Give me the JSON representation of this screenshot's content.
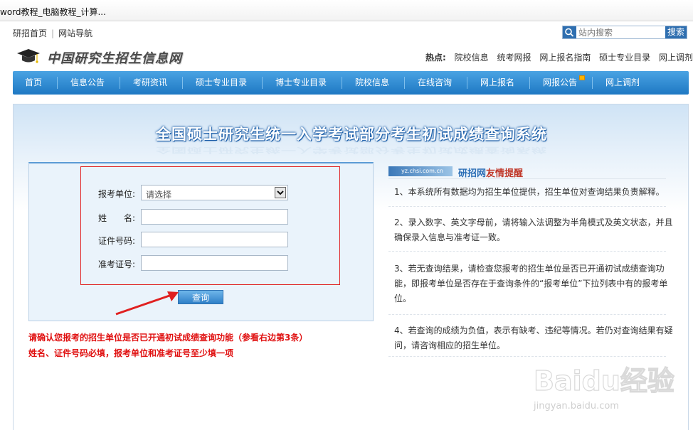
{
  "browser": {
    "tab_title": "word教程_电脑教程_计算..."
  },
  "topbar": {
    "home_link": "研招首页",
    "nav_link": "网站导航",
    "search_placeholder": "站内搜索",
    "search_button": "搜索"
  },
  "header": {
    "logo_text": "中国研究生招生信息网",
    "hot_label": "热点:",
    "hot_links": [
      "院校信息",
      "统考网报",
      "网上报名指南",
      "硕士专业目录",
      "网上调剂"
    ]
  },
  "nav": {
    "items": [
      "首页",
      "信息公告",
      "考研资讯",
      "硕士专业目录",
      "博士专业目录",
      "院校信息",
      "在线咨询",
      "网上报名",
      "网报公告",
      "网上调剂"
    ]
  },
  "main": {
    "title": "全国硕士研究生统一入学考试部分考生初试成绩查询系统",
    "form": {
      "unit_label": "报考单位:",
      "unit_value": "请选择",
      "name_label": "姓　　名:",
      "id_label": "证件号码:",
      "ticket_label": "准考证号:",
      "query_button": "查询"
    },
    "notes": [
      "请确认您报考的招生单位是否已开通初试成绩查询功能（参看右边第3条）",
      "姓名、证件号码必填，报考单位和准考证号至少填一项"
    ],
    "tips": {
      "logo_text": "yz.chsi.com.cn",
      "title_a": "研招网",
      "title_b": "友情提醒",
      "items": [
        "1、本系统所有数据均为招生单位提供，招生单位对查询结果负责解释。",
        "2、录入数字、英文字母前，请将输入法调整为半角模式及英文状态，并且确保录入信息与准考证一致。",
        "3、若无查询结果，请检查您报考的招生单位是否已开通初试成绩查询功能，即报考单位是否存在于查询条件的“报考单位”下拉列表中有的报考单位。",
        "4、若查询的成绩为负值，表示有缺考、违纪等情况。若仍对查询结果有疑问，请咨询相应的招生单位。"
      ]
    }
  },
  "watermark": {
    "text": "Baidu经验",
    "url": "jingyan.baidu.com"
  }
}
